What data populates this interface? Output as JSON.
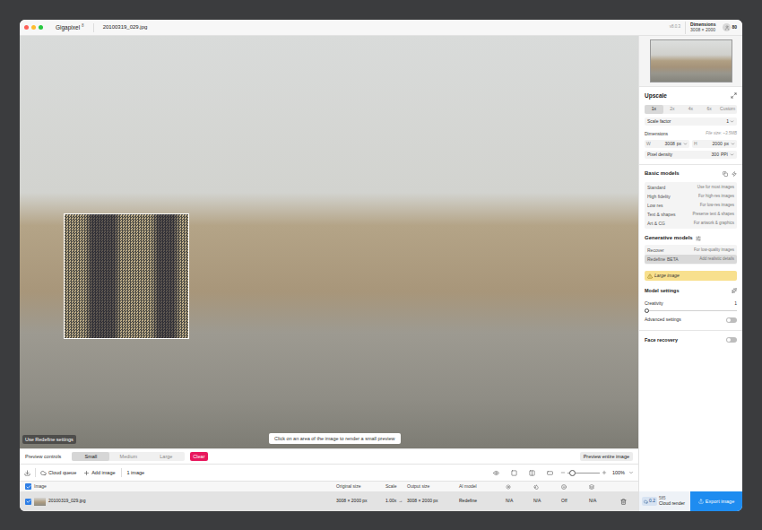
{
  "window": {
    "title": "Gigapixel",
    "version_badge": "8",
    "file": "20100319_029.jpg",
    "version": "v8.0.3",
    "dimensions_label": "Dimensions",
    "dimensions": "3008 × 2000",
    "credits": "80"
  },
  "preview": {
    "hint": "Use Redefine settings",
    "tooltip": "Click on an area of the image to render a small preview"
  },
  "preview_controls": {
    "label": "Preview controls",
    "sizes": [
      {
        "label": "Small",
        "selected": true
      },
      {
        "label": "Medium",
        "selected": false
      },
      {
        "label": "Large",
        "selected": false
      }
    ],
    "clear": "Clear",
    "preview_all": "Preview entire image"
  },
  "toolbar": {
    "cloud_queue": "Cloud queue",
    "add_image": "Add image",
    "count": "1 image",
    "zoom_level": 0.15,
    "zoom": "100%"
  },
  "table": {
    "columns": [
      "Image",
      "Original size",
      "Scale",
      "Output size",
      "AI model"
    ],
    "all_checked": true,
    "rows": [
      {
        "checked": true,
        "selected": true,
        "name": "20100319_029.jpg",
        "original": "3008 × 2000 px",
        "scale": "1.00x",
        "arrow": "→",
        "output": "3008 × 2000 px",
        "model": "Redefine",
        "flags": [
          "N/A",
          "N/A",
          "Off",
          "N/A"
        ]
      }
    ]
  },
  "export": {
    "credits": "585",
    "cloud": "Cloud render",
    "cost": "0.2",
    "button": "Export image"
  },
  "sidebar": {
    "upscale": {
      "title": "Upscale",
      "scales": [
        {
          "label": "1x",
          "selected": true
        },
        {
          "label": "2x",
          "selected": false
        },
        {
          "label": "4x",
          "selected": false
        },
        {
          "label": "6x",
          "selected": false
        },
        {
          "label": "Custom",
          "selected": false
        }
      ],
      "scale_factor": {
        "label": "Scale factor",
        "value": "1"
      },
      "dimensions": {
        "label": "Dimensions",
        "file_size": "File size: ~3.5MB",
        "width_label": "W",
        "width": "3008",
        "width_unit": "px",
        "height_label": "H",
        "height": "2000",
        "height_unit": "px"
      },
      "density": {
        "label": "Pixel density",
        "value": "300",
        "unit": "PPI"
      }
    },
    "basic_models": {
      "title": "Basic models",
      "items": [
        {
          "name": "Standard",
          "tag": "",
          "desc": "Use for most images",
          "selected": false
        },
        {
          "name": "High fidelity",
          "tag": "",
          "desc": "For high-res images",
          "selected": false
        },
        {
          "name": "Low res",
          "tag": "",
          "desc": "For low-res images",
          "selected": false
        },
        {
          "name": "Text & shapes",
          "tag": "",
          "desc": "Preserve text & shapes",
          "selected": false
        },
        {
          "name": "Art & CG",
          "tag": "",
          "desc": "For artwork & graphics",
          "selected": false
        }
      ]
    },
    "generative_models": {
      "title": "Generative models",
      "items": [
        {
          "name": "Recover",
          "tag": "",
          "desc": "For low-quality images",
          "selected": false
        },
        {
          "name": "Redefine",
          "tag": "BETA",
          "desc": "Add realistic details",
          "selected": true
        }
      ]
    },
    "warning": "Large image",
    "model_settings": {
      "title": "Model settings",
      "creativity": {
        "label": "Creativity",
        "value": "1",
        "level": 0
      },
      "advanced": {
        "label": "Advanced settings",
        "on": false
      }
    },
    "face_recovery": {
      "label": "Face recovery",
      "on": false
    }
  }
}
